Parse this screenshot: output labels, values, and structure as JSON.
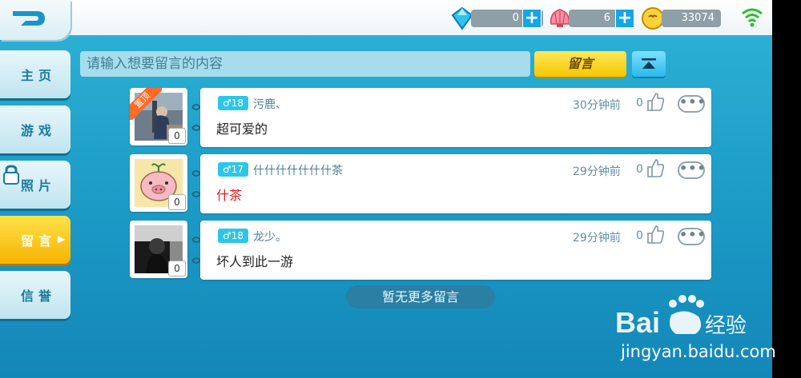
{
  "topbar": {
    "currencies": [
      {
        "icon": "diamond-icon",
        "value": "0"
      },
      {
        "icon": "shell-icon",
        "value": "6"
      },
      {
        "icon": "coin-icon",
        "value": "33074"
      }
    ]
  },
  "sidebar": {
    "items": [
      {
        "label": "主页"
      },
      {
        "label": "游戏"
      },
      {
        "label": "照片"
      },
      {
        "label": "留言"
      },
      {
        "label": "信誉"
      }
    ]
  },
  "composer": {
    "placeholder": "请输入想要留言的内容",
    "post_label": "留言"
  },
  "pinned_ribbon": "置顶",
  "messages": [
    {
      "gender": "♂18",
      "username": "污鹿、",
      "text": "超可爱的",
      "time": "30分钟前",
      "likes": "0",
      "photo_count": "0"
    },
    {
      "gender": "♂17",
      "username": "什什什什什什什茶",
      "text": "什茶",
      "time": "29分钟前",
      "likes": "0",
      "photo_count": "0"
    },
    {
      "gender": "♂18",
      "username": "龙少。",
      "text": "坏人到此一游",
      "time": "29分钟前",
      "likes": "0",
      "photo_count": "0"
    }
  ],
  "no_more_label": "暂无更多留言",
  "watermark": {
    "text": "jingyan.baidu.com",
    "logo": "Bai度经验"
  },
  "colors": {
    "accent": "#f8c600",
    "primary": "#2ab8ec",
    "highlight_text": "#e21a1a"
  }
}
